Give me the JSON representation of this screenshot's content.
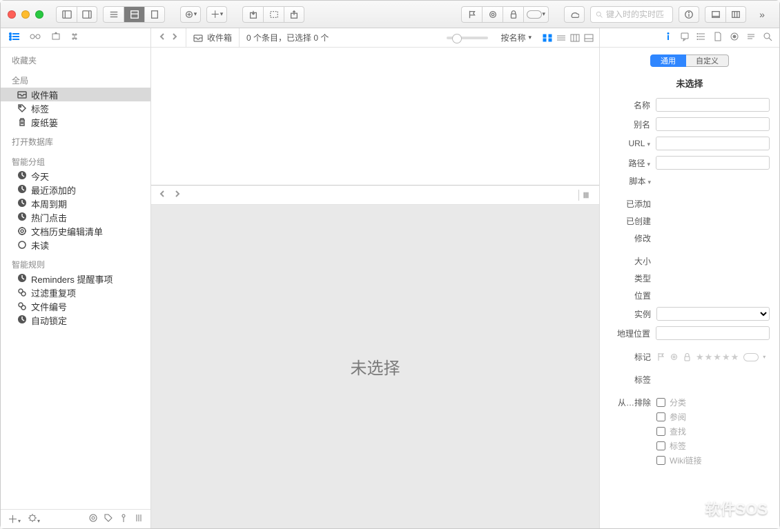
{
  "toolbar": {
    "search_placeholder": "键入时的实时匹"
  },
  "sidebar": {
    "sections": {
      "fav": "收藏夹",
      "global": "全局",
      "open_db": "打开数据库",
      "smart_groups": "智能分组",
      "smart_rules": "智能规则"
    },
    "global": {
      "inbox": "收件箱",
      "tags": "标签",
      "trash": "废纸篓"
    },
    "smart_groups": {
      "today": "今天",
      "recent": "最近添加的",
      "due": "本周到期",
      "hot": "热门点击",
      "history": "文档历史编辑清单",
      "unread": "未读"
    },
    "smart_rules": {
      "reminders": "Reminders 提醒事项",
      "dupes": "过滤重复项",
      "numbering": "文件编号",
      "autolock": "自动锁定"
    }
  },
  "center": {
    "crumb": "收件箱",
    "status": "0 个条目，已选择 0 个",
    "sort": "按名称",
    "preview": "未选择"
  },
  "inspector": {
    "tabs": {
      "general": "通用",
      "custom": "自定义"
    },
    "title": "未选择",
    "labels": {
      "name": "名称",
      "alias": "别名",
      "url": "URL",
      "path": "路径",
      "script": "脚本",
      "added": "已添加",
      "created": "已创建",
      "modified": "修改",
      "size": "大小",
      "type": "类型",
      "location": "位置",
      "instance": "实例",
      "geo": "地理位置",
      "marks": "标记",
      "tags": "标签",
      "exclude": "从…排除"
    },
    "exclude": {
      "classify": "分类",
      "see": "参阅",
      "find": "查找",
      "tag": "标签",
      "wiki": "Wiki链接"
    }
  },
  "watermark": "软件SOS"
}
